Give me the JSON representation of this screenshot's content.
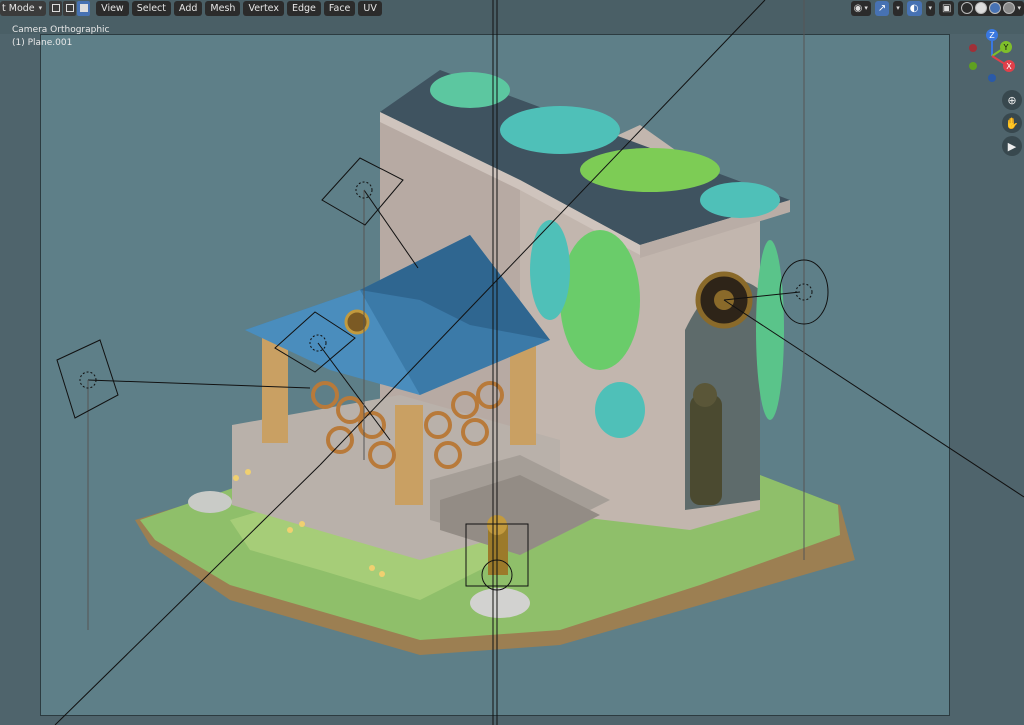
{
  "header": {
    "mode_label": "t Mode",
    "menu": [
      "View",
      "Select",
      "Add",
      "Mesh",
      "Vertex",
      "Edge",
      "Face",
      "UV"
    ]
  },
  "viewport": {
    "camera_label": "Camera Orthographic",
    "object_label": "(1) Plane.001"
  },
  "gizmo": {
    "z_label": "Z",
    "y_label": "Y",
    "x_label": "X"
  },
  "colors": {
    "toolbar_bg": "#2b2b2b",
    "accent": "#4772b3",
    "axis_x": "#e0404a",
    "axis_y": "#7fbf2a",
    "axis_z": "#3a78e0"
  },
  "icons": {
    "nav": [
      "zoom-icon",
      "hand-pan-icon",
      "camera-icon"
    ]
  }
}
